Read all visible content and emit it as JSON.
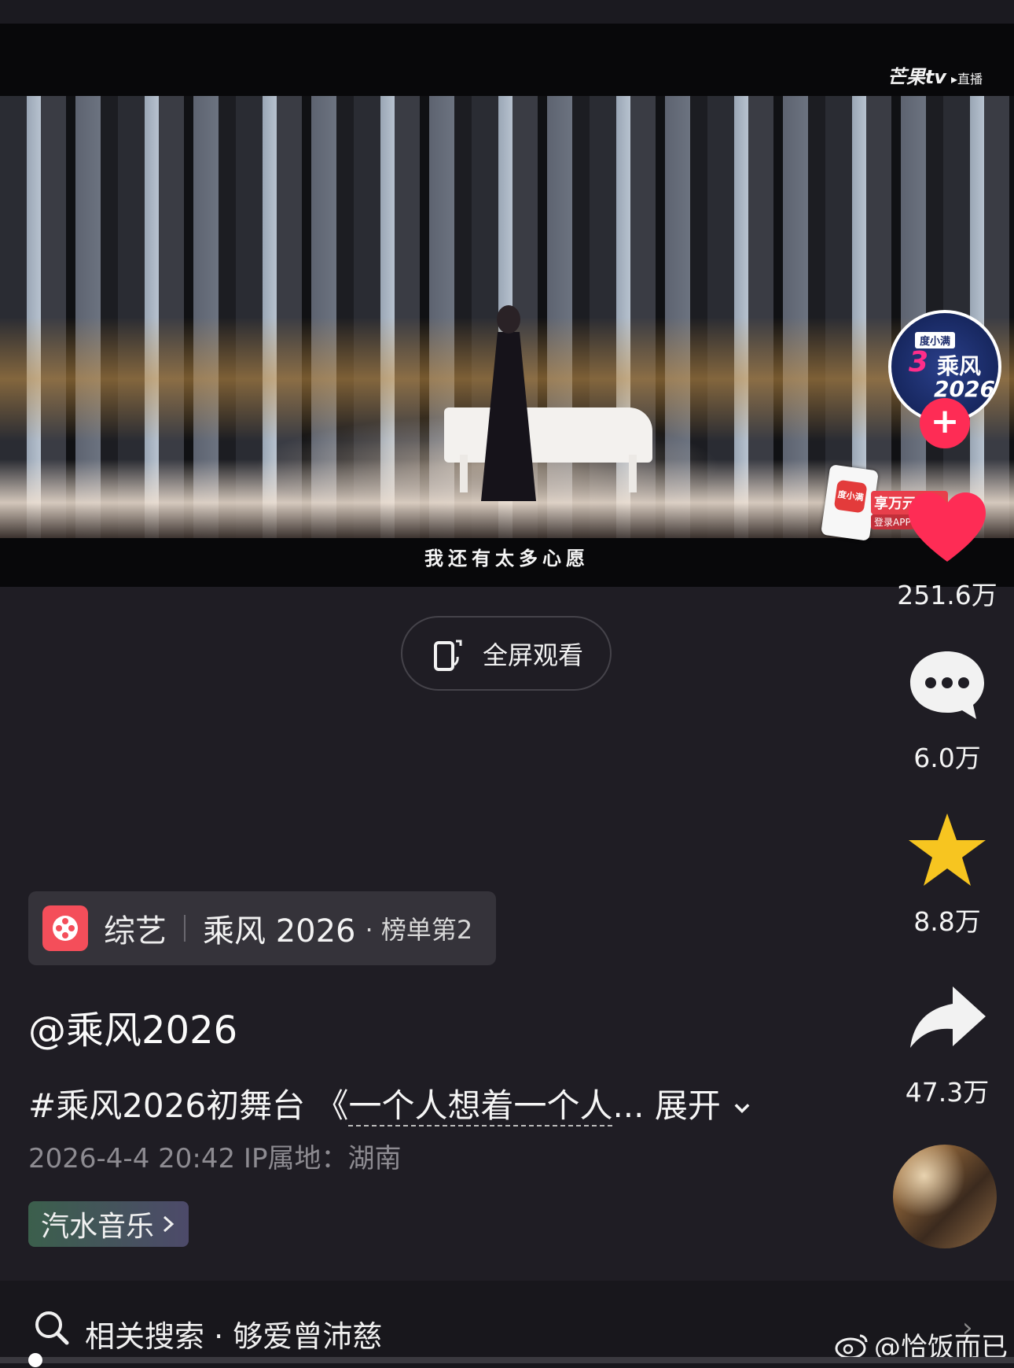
{
  "video": {
    "subtitle": "我还有太多心愿",
    "logo": "芒果tv",
    "logo_live": "▸直播",
    "ad": {
      "app_icon": "度小满",
      "line1": "享万元现金",
      "line2": "登录APP"
    }
  },
  "fullscreen": {
    "label": "全屏观看"
  },
  "actions": {
    "avatar": {
      "tag": "度小满",
      "mark": "3",
      "text1": "乘风",
      "text2": "2026"
    },
    "follow_symbol": "+",
    "likes": "251.6万",
    "comments": "6.0万",
    "favorites": "8.8万",
    "shares": "47.3万"
  },
  "tag": {
    "category": "综艺",
    "name": "乘风 2026",
    "rank": "· 榜单第2"
  },
  "post": {
    "author": "@乘风2026",
    "desc_prefix": "#乘风2026初舞台 《",
    "desc_link": "一个人想着一个人",
    "desc_more": "... 展开",
    "meta": "2026-4-4 20:42  IP属地：湖南",
    "music": "汽水音乐"
  },
  "search": {
    "text": "相关搜索 · 够爱曾沛慈",
    "chevron": "›"
  },
  "watermark": "@恰饭而已",
  "colors": {
    "accent": "#fe2c55",
    "star": "#f7c520",
    "background": "#1f1d24"
  }
}
